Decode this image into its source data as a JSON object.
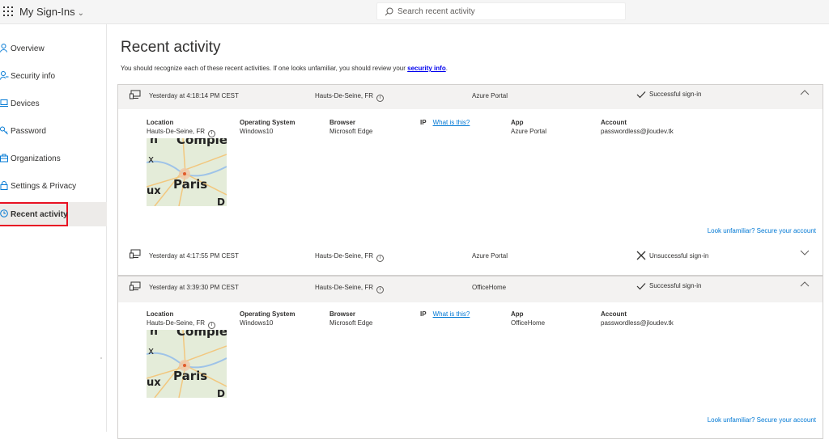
{
  "app": {
    "title": "My Sign-Ins"
  },
  "search": {
    "placeholder": "Search recent activity"
  },
  "sidebar": {
    "items": [
      {
        "label": "Overview",
        "icon": "person-icon"
      },
      {
        "label": "Security info",
        "icon": "key-person-icon"
      },
      {
        "label": "Devices",
        "icon": "laptop-icon"
      },
      {
        "label": "Password",
        "icon": "key-icon"
      },
      {
        "label": "Organizations",
        "icon": "briefcase-icon"
      },
      {
        "label": "Settings & Privacy",
        "icon": "lock-icon"
      },
      {
        "label": "Recent activity",
        "icon": "clock-icon",
        "active": true
      }
    ]
  },
  "main": {
    "title": "Recent activity",
    "subtitle_prefix": "You should recognize each of these recent activities. If one looks unfamiliar, you should review your ",
    "subtitle_link": "security info",
    "subtitle_suffix": "."
  },
  "labels": {
    "location": "Location",
    "os": "Operating System",
    "browser": "Browser",
    "ip": "IP",
    "ip_link": "What is this?",
    "app": "App",
    "account": "Account",
    "secure_link": "Look unfamiliar? Secure your account"
  },
  "activities": [
    {
      "time": "Yesterday at 4:18:14 PM CEST",
      "location": "Hauts-De-Seine, FR",
      "app": "Azure Portal",
      "status": "Successful sign-in",
      "success": true,
      "expanded": true,
      "os": "Windows10",
      "browser": "Microsoft Edge",
      "account": "passwordless@jloudev.tk"
    },
    {
      "time": "Yesterday at 4:17:55 PM CEST",
      "location": "Hauts-De-Seine, FR",
      "app": "Azure Portal",
      "status": "Unsuccessful sign-in",
      "success": false,
      "expanded": false
    },
    {
      "time": "Yesterday at 3:39:30 PM CEST",
      "location": "Hauts-De-Seine, FR",
      "app": "OfficeHome",
      "status": "Successful sign-in",
      "success": true,
      "expanded": true,
      "os": "Windows10",
      "browser": "Microsoft Edge",
      "account": "passwordless@jloudev.tk"
    }
  ],
  "map": {
    "labels": [
      "Compie",
      "n",
      "x",
      "Paris",
      "ux",
      "D"
    ]
  },
  "colors": {
    "accent": "#0078d4",
    "active_outline": "#e81123",
    "header_bg": "#f3f2f1"
  }
}
